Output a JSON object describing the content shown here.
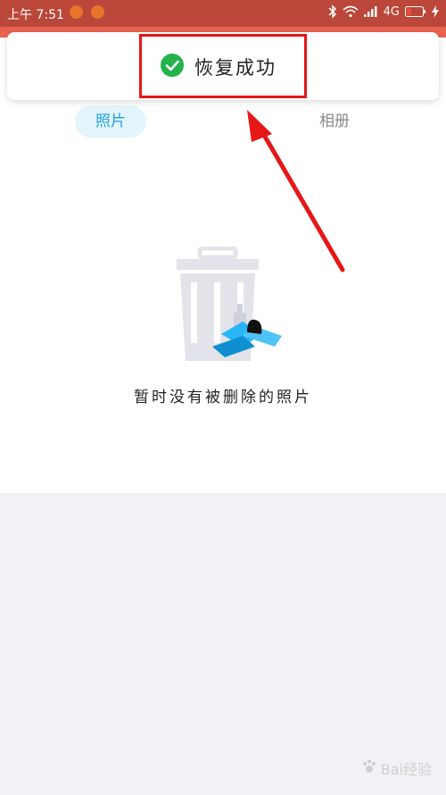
{
  "status_bar": {
    "time": "上午 7:51",
    "network": "4G"
  },
  "toast": {
    "message": "恢复成功",
    "icon": "check-circle-icon",
    "icon_color": "#23b24b"
  },
  "tabs": [
    {
      "label": "照片",
      "active": true
    },
    {
      "label": "相册",
      "active": false
    }
  ],
  "empty_state": {
    "message": "暂时没有被删除的照片",
    "icon": "trash-bin-icon"
  },
  "annotation": {
    "box_color": "#e61717",
    "arrow_color": "#e61717"
  },
  "watermark": {
    "text": "Bai经验"
  },
  "colors": {
    "status_bar_bg": "#ba4739",
    "header_bg": "#e8624f",
    "accent": "#1ea4dc"
  }
}
